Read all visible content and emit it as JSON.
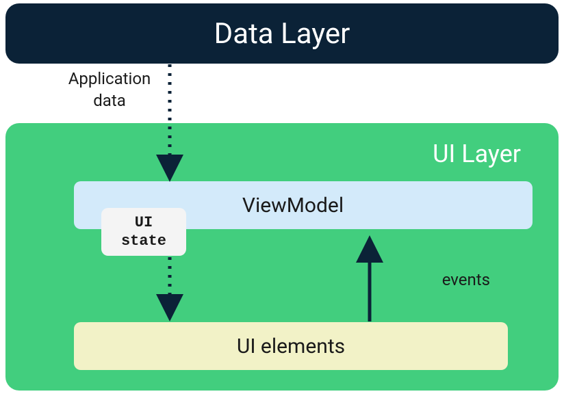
{
  "diagram": {
    "dataLayer": {
      "title": "Data Layer"
    },
    "appDataLabel": "Application data",
    "uiLayer": {
      "title": "UI Layer",
      "viewModel": "ViewModel",
      "uiState": "UI\nstate",
      "uiElements": "UI elements",
      "eventsLabel": "events"
    },
    "colors": {
      "dataLayerBg": "#0b2237",
      "uiLayerBg": "#42ce7e",
      "viewModelBg": "#d3eafa",
      "uiStateBg": "#f4f4f4",
      "uiElementsBg": "#f2f2c7",
      "arrowColor": "#0b2237"
    }
  }
}
